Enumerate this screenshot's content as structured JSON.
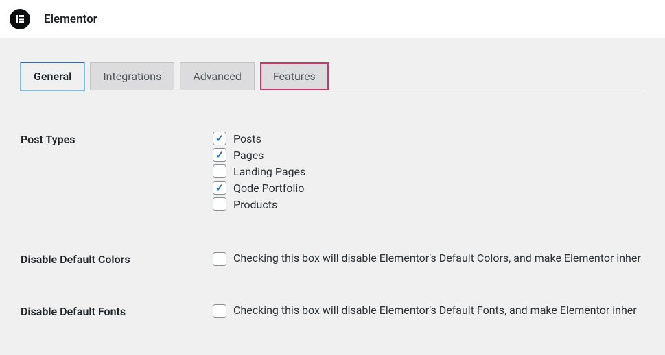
{
  "header": {
    "title": "Elementor"
  },
  "tabs": [
    {
      "label": "General",
      "active": true,
      "highlighted": false
    },
    {
      "label": "Integrations",
      "active": false,
      "highlighted": false
    },
    {
      "label": "Advanced",
      "active": false,
      "highlighted": false
    },
    {
      "label": "Features",
      "active": false,
      "highlighted": true
    }
  ],
  "settings": {
    "post_types": {
      "label": "Post Types",
      "items": [
        {
          "label": "Posts",
          "checked": true
        },
        {
          "label": "Pages",
          "checked": true
        },
        {
          "label": "Landing Pages",
          "checked": false
        },
        {
          "label": "Qode Portfolio",
          "checked": true
        },
        {
          "label": "Products",
          "checked": false
        }
      ]
    },
    "disable_colors": {
      "label": "Disable Default Colors",
      "checked": false,
      "description": "Checking this box will disable Elementor's Default Colors, and make Elementor inher"
    },
    "disable_fonts": {
      "label": "Disable Default Fonts",
      "checked": false,
      "description": "Checking this box will disable Elementor's Default Fonts, and make Elementor inher"
    }
  }
}
